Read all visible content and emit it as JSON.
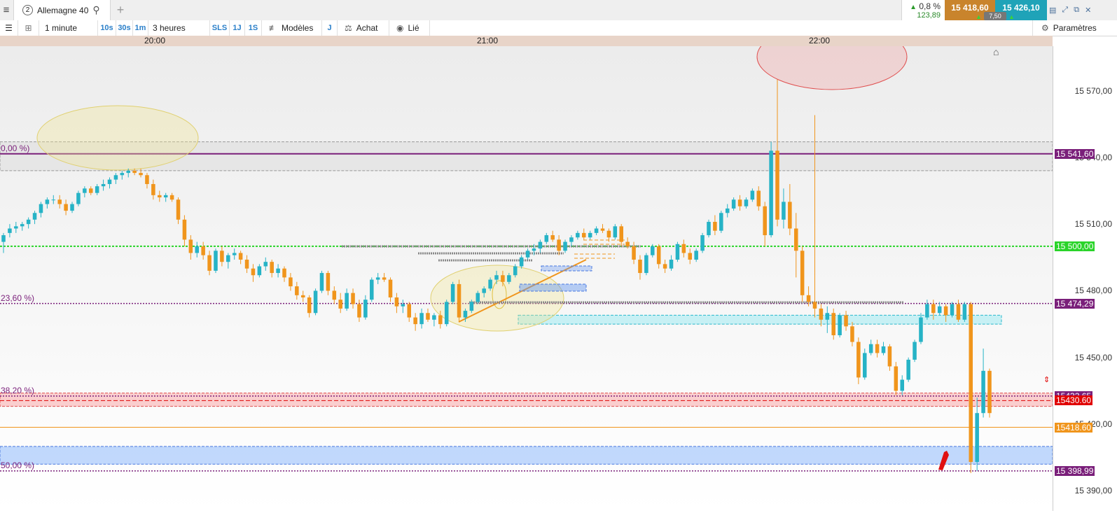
{
  "topbar": {
    "tab_number": "2",
    "instrument": "Allemagne 40",
    "change_pct": "0,8 %",
    "change_pts": "123,89",
    "sell_price": "15 418,60",
    "buy_price": "15 426,10",
    "spread": "7,50"
  },
  "toolbar": {
    "timeframe": "1 minute",
    "tf_10s": "10s",
    "tf_30s": "30s",
    "tf_1m": "1m",
    "range": "3 heures",
    "sls": "SLS",
    "one_j": "1J",
    "one_s": "1S",
    "models": "Modèles",
    "j": "J",
    "buy": "Achat",
    "linked": "Lié",
    "settings": "Paramètres"
  },
  "colors": {
    "bull": "#26b3c6",
    "bear": "#f0951c",
    "fib": "#7a1f7a",
    "green_level": "#2ad42a",
    "order_red": "#e00000",
    "price_orange": "#f0951c"
  },
  "chart_data": {
    "type": "candlestick",
    "instrument": "Allemagne 40",
    "timeframe": "1 minute",
    "x_labels": [
      "20:00",
      "21:00",
      "22:00"
    ],
    "y_ticks": [
      15390,
      15420,
      15450,
      15480,
      15510,
      15540,
      15570
    ],
    "y_tick_labels": [
      "15 390,00",
      "15 420,00",
      "15 450,00",
      "15 480,00",
      "15 510,00",
      "15 540,00",
      "15 570,00"
    ],
    "ylim": [
      15381,
      15590
    ],
    "fib_levels": [
      {
        "label": "0,00 %)",
        "price": 15541.6,
        "tag": "15 541,60"
      },
      {
        "label": "23,60 %)",
        "price": 15474.29,
        "tag": "15 474,29"
      },
      {
        "label": "38,20 %)",
        "price": 15432.65,
        "tag": "15432.65"
      },
      {
        "label": "50,00 %)",
        "price": 15398.99,
        "tag": "15 398,99"
      }
    ],
    "horizontal_levels": [
      {
        "name": "support",
        "price": 15500.0,
        "tag": "15 500,00"
      },
      {
        "name": "order",
        "price": 15430.6,
        "tag": "15430.60"
      },
      {
        "name": "current",
        "price": 15418.6,
        "tag": "15418.60"
      }
    ],
    "zones": [
      {
        "name": "upper-gray",
        "from": 15534,
        "to": 15547
      },
      {
        "name": "red-band",
        "from": 15428,
        "to": 15434
      },
      {
        "name": "blue-zone",
        "from": 15402,
        "to": 15410
      },
      {
        "name": "cyan-zone",
        "from": 15465,
        "to": 15469
      }
    ],
    "candles": [
      {
        "o": 15502,
        "h": 15506,
        "l": 15497,
        "c": 15505
      },
      {
        "o": 15506,
        "h": 15510,
        "l": 15504,
        "c": 15508
      },
      {
        "o": 15508,
        "h": 15511,
        "l": 15506,
        "c": 15509
      },
      {
        "o": 15509,
        "h": 15511,
        "l": 15507,
        "c": 15510
      },
      {
        "o": 15510,
        "h": 15513,
        "l": 15508,
        "c": 15512
      },
      {
        "o": 15512,
        "h": 15516,
        "l": 15510,
        "c": 15515
      },
      {
        "o": 15515,
        "h": 15520,
        "l": 15513,
        "c": 15519
      },
      {
        "o": 15519,
        "h": 15522,
        "l": 15517,
        "c": 15521
      },
      {
        "o": 15521,
        "h": 15523,
        "l": 15519,
        "c": 15521
      },
      {
        "o": 15521,
        "h": 15523,
        "l": 15517,
        "c": 15519
      },
      {
        "o": 15519,
        "h": 15521,
        "l": 15514,
        "c": 15516
      },
      {
        "o": 15516,
        "h": 15520,
        "l": 15515,
        "c": 15519
      },
      {
        "o": 15519,
        "h": 15525,
        "l": 15518,
        "c": 15524
      },
      {
        "o": 15524,
        "h": 15527,
        "l": 15522,
        "c": 15526
      },
      {
        "o": 15526,
        "h": 15527,
        "l": 15523,
        "c": 15524
      },
      {
        "o": 15524,
        "h": 15528,
        "l": 15523,
        "c": 15527
      },
      {
        "o": 15527,
        "h": 15530,
        "l": 15525,
        "c": 15528
      },
      {
        "o": 15528,
        "h": 15531,
        "l": 15526,
        "c": 15530
      },
      {
        "o": 15530,
        "h": 15533,
        "l": 15528,
        "c": 15532
      },
      {
        "o": 15532,
        "h": 15534,
        "l": 15530,
        "c": 15533
      },
      {
        "o": 15533,
        "h": 15535,
        "l": 15531,
        "c": 15534
      },
      {
        "o": 15534,
        "h": 15535,
        "l": 15532,
        "c": 15533
      },
      {
        "o": 15533,
        "h": 15535,
        "l": 15531,
        "c": 15532
      },
      {
        "o": 15532,
        "h": 15533,
        "l": 15526,
        "c": 15528
      },
      {
        "o": 15528,
        "h": 15530,
        "l": 15521,
        "c": 15523
      },
      {
        "o": 15523,
        "h": 15525,
        "l": 15520,
        "c": 15522
      },
      {
        "o": 15522,
        "h": 15524,
        "l": 15520,
        "c": 15523
      },
      {
        "o": 15523,
        "h": 15524,
        "l": 15520,
        "c": 15521
      },
      {
        "o": 15521,
        "h": 15522,
        "l": 15510,
        "c": 15512
      },
      {
        "o": 15512,
        "h": 15514,
        "l": 15500,
        "c": 15503
      },
      {
        "o": 15503,
        "h": 15505,
        "l": 15494,
        "c": 15497
      },
      {
        "o": 15497,
        "h": 15502,
        "l": 15495,
        "c": 15500
      },
      {
        "o": 15500,
        "h": 15502,
        "l": 15494,
        "c": 15496
      },
      {
        "o": 15496,
        "h": 15498,
        "l": 15487,
        "c": 15489
      },
      {
        "o": 15489,
        "h": 15499,
        "l": 15488,
        "c": 15498
      },
      {
        "o": 15498,
        "h": 15500,
        "l": 15491,
        "c": 15493
      },
      {
        "o": 15493,
        "h": 15497,
        "l": 15490,
        "c": 15496
      },
      {
        "o": 15496,
        "h": 15499,
        "l": 15494,
        "c": 15497
      },
      {
        "o": 15497,
        "h": 15498,
        "l": 15492,
        "c": 15494
      },
      {
        "o": 15494,
        "h": 15496,
        "l": 15488,
        "c": 15490
      },
      {
        "o": 15490,
        "h": 15492,
        "l": 15484,
        "c": 15487
      },
      {
        "o": 15487,
        "h": 15492,
        "l": 15486,
        "c": 15491
      },
      {
        "o": 15491,
        "h": 15495,
        "l": 15489,
        "c": 15493
      },
      {
        "o": 15493,
        "h": 15494,
        "l": 15486,
        "c": 15488
      },
      {
        "o": 15488,
        "h": 15492,
        "l": 15486,
        "c": 15490
      },
      {
        "o": 15490,
        "h": 15491,
        "l": 15484,
        "c": 15486
      },
      {
        "o": 15486,
        "h": 15488,
        "l": 15480,
        "c": 15482
      },
      {
        "o": 15482,
        "h": 15484,
        "l": 15476,
        "c": 15478
      },
      {
        "o": 15478,
        "h": 15480,
        "l": 15475,
        "c": 15477
      },
      {
        "o": 15477,
        "h": 15478,
        "l": 15468,
        "c": 15470
      },
      {
        "o": 15470,
        "h": 15481,
        "l": 15469,
        "c": 15480
      },
      {
        "o": 15480,
        "h": 15489,
        "l": 15479,
        "c": 15488
      },
      {
        "o": 15488,
        "h": 15489,
        "l": 15478,
        "c": 15480
      },
      {
        "o": 15480,
        "h": 15482,
        "l": 15474,
        "c": 15476
      },
      {
        "o": 15476,
        "h": 15479,
        "l": 15470,
        "c": 15472
      },
      {
        "o": 15472,
        "h": 15481,
        "l": 15471,
        "c": 15479
      },
      {
        "o": 15479,
        "h": 15481,
        "l": 15472,
        "c": 15474
      },
      {
        "o": 15474,
        "h": 15476,
        "l": 15466,
        "c": 15468
      },
      {
        "o": 15468,
        "h": 15478,
        "l": 15467,
        "c": 15476
      },
      {
        "o": 15476,
        "h": 15486,
        "l": 15475,
        "c": 15485
      },
      {
        "o": 15485,
        "h": 15488,
        "l": 15483,
        "c": 15486
      },
      {
        "o": 15486,
        "h": 15488,
        "l": 15484,
        "c": 15485
      },
      {
        "o": 15485,
        "h": 15486,
        "l": 15475,
        "c": 15477
      },
      {
        "o": 15477,
        "h": 15479,
        "l": 15470,
        "c": 15473
      },
      {
        "o": 15473,
        "h": 15476,
        "l": 15470,
        "c": 15474
      },
      {
        "o": 15474,
        "h": 15475,
        "l": 15466,
        "c": 15468
      },
      {
        "o": 15468,
        "h": 15470,
        "l": 15462,
        "c": 15465
      },
      {
        "o": 15465,
        "h": 15472,
        "l": 15463,
        "c": 15470
      },
      {
        "o": 15470,
        "h": 15472,
        "l": 15466,
        "c": 15467
      },
      {
        "o": 15467,
        "h": 15470,
        "l": 15464,
        "c": 15469
      },
      {
        "o": 15469,
        "h": 15471,
        "l": 15463,
        "c": 15465
      },
      {
        "o": 15465,
        "h": 15476,
        "l": 15464,
        "c": 15475
      },
      {
        "o": 15475,
        "h": 15484,
        "l": 15474,
        "c": 15483
      },
      {
        "o": 15483,
        "h": 15485,
        "l": 15466,
        "c": 15468
      },
      {
        "o": 15468,
        "h": 15472,
        "l": 15466,
        "c": 15471
      },
      {
        "o": 15471,
        "h": 15476,
        "l": 15470,
        "c": 15475
      },
      {
        "o": 15475,
        "h": 15480,
        "l": 15474,
        "c": 15479
      },
      {
        "o": 15479,
        "h": 15482,
        "l": 15477,
        "c": 15481
      },
      {
        "o": 15481,
        "h": 15486,
        "l": 15480,
        "c": 15485
      },
      {
        "o": 15485,
        "h": 15489,
        "l": 15483,
        "c": 15487
      },
      {
        "o": 15487,
        "h": 15489,
        "l": 15482,
        "c": 15484
      },
      {
        "o": 15484,
        "h": 15488,
        "l": 15483,
        "c": 15487
      },
      {
        "o": 15487,
        "h": 15492,
        "l": 15486,
        "c": 15491
      },
      {
        "o": 15491,
        "h": 15496,
        "l": 15490,
        "c": 15495
      },
      {
        "o": 15495,
        "h": 15499,
        "l": 15494,
        "c": 15498
      },
      {
        "o": 15498,
        "h": 15501,
        "l": 15496,
        "c": 15499
      },
      {
        "o": 15499,
        "h": 15503,
        "l": 15497,
        "c": 15502
      },
      {
        "o": 15502,
        "h": 15506,
        "l": 15501,
        "c": 15505
      },
      {
        "o": 15505,
        "h": 15507,
        "l": 15502,
        "c": 15503
      },
      {
        "o": 15503,
        "h": 15505,
        "l": 15496,
        "c": 15498
      },
      {
        "o": 15498,
        "h": 15503,
        "l": 15497,
        "c": 15502
      },
      {
        "o": 15502,
        "h": 15505,
        "l": 15500,
        "c": 15504
      },
      {
        "o": 15504,
        "h": 15507,
        "l": 15503,
        "c": 15506
      },
      {
        "o": 15506,
        "h": 15508,
        "l": 15503,
        "c": 15504
      },
      {
        "o": 15504,
        "h": 15507,
        "l": 15503,
        "c": 15506
      },
      {
        "o": 15506,
        "h": 15509,
        "l": 15505,
        "c": 15508
      },
      {
        "o": 15508,
        "h": 15510,
        "l": 15506,
        "c": 15507
      },
      {
        "o": 15507,
        "h": 15508,
        "l": 15502,
        "c": 15504
      },
      {
        "o": 15504,
        "h": 15510,
        "l": 15503,
        "c": 15509
      },
      {
        "o": 15509,
        "h": 15510,
        "l": 15500,
        "c": 15502
      },
      {
        "o": 15502,
        "h": 15504,
        "l": 15499,
        "c": 15500
      },
      {
        "o": 15500,
        "h": 15502,
        "l": 15492,
        "c": 15494
      },
      {
        "o": 15494,
        "h": 15496,
        "l": 15485,
        "c": 15488
      },
      {
        "o": 15488,
        "h": 15497,
        "l": 15487,
        "c": 15496
      },
      {
        "o": 15496,
        "h": 15501,
        "l": 15495,
        "c": 15500
      },
      {
        "o": 15500,
        "h": 15501,
        "l": 15490,
        "c": 15492
      },
      {
        "o": 15492,
        "h": 15494,
        "l": 15488,
        "c": 15490
      },
      {
        "o": 15490,
        "h": 15496,
        "l": 15489,
        "c": 15494
      },
      {
        "o": 15494,
        "h": 15502,
        "l": 15493,
        "c": 15501
      },
      {
        "o": 15501,
        "h": 15503,
        "l": 15495,
        "c": 15497
      },
      {
        "o": 15497,
        "h": 15499,
        "l": 15492,
        "c": 15494
      },
      {
        "o": 15494,
        "h": 15499,
        "l": 15493,
        "c": 15498
      },
      {
        "o": 15498,
        "h": 15506,
        "l": 15497,
        "c": 15505
      },
      {
        "o": 15505,
        "h": 15512,
        "l": 15504,
        "c": 15511
      },
      {
        "o": 15511,
        "h": 15514,
        "l": 15505,
        "c": 15507
      },
      {
        "o": 15507,
        "h": 15516,
        "l": 15506,
        "c": 15515
      },
      {
        "o": 15515,
        "h": 15519,
        "l": 15513,
        "c": 15517
      },
      {
        "o": 15517,
        "h": 15522,
        "l": 15516,
        "c": 15521
      },
      {
        "o": 15521,
        "h": 15523,
        "l": 15516,
        "c": 15518
      },
      {
        "o": 15518,
        "h": 15522,
        "l": 15517,
        "c": 15521
      },
      {
        "o": 15521,
        "h": 15526,
        "l": 15520,
        "c": 15525
      },
      {
        "o": 15525,
        "h": 15527,
        "l": 15516,
        "c": 15518
      },
      {
        "o": 15518,
        "h": 15520,
        "l": 15500,
        "c": 15505
      },
      {
        "o": 15505,
        "h": 15547,
        "l": 15504,
        "c": 15543
      },
      {
        "o": 15543,
        "h": 15575,
        "l": 15509,
        "c": 15512
      },
      {
        "o": 15512,
        "h": 15526,
        "l": 15508,
        "c": 15520
      },
      {
        "o": 15520,
        "h": 15528,
        "l": 15505,
        "c": 15508
      },
      {
        "o": 15508,
        "h": 15515,
        "l": 15486,
        "c": 15498
      },
      {
        "o": 15498,
        "h": 15500,
        "l": 15475,
        "c": 15478
      },
      {
        "o": 15478,
        "h": 15482,
        "l": 15473,
        "c": 15475
      },
      {
        "o": 15475,
        "h": 15559,
        "l": 15468,
        "c": 15472
      },
      {
        "o": 15472,
        "h": 15474,
        "l": 15464,
        "c": 15467
      },
      {
        "o": 15467,
        "h": 15473,
        "l": 15461,
        "c": 15470
      },
      {
        "o": 15470,
        "h": 15472,
        "l": 15458,
        "c": 15460
      },
      {
        "o": 15460,
        "h": 15470,
        "l": 15459,
        "c": 15469
      },
      {
        "o": 15469,
        "h": 15471,
        "l": 15462,
        "c": 15464
      },
      {
        "o": 15464,
        "h": 15466,
        "l": 15455,
        "c": 15457
      },
      {
        "o": 15457,
        "h": 15459,
        "l": 15438,
        "c": 15441
      },
      {
        "o": 15441,
        "h": 15454,
        "l": 15440,
        "c": 15452
      },
      {
        "o": 15452,
        "h": 15458,
        "l": 15451,
        "c": 15456
      },
      {
        "o": 15456,
        "h": 15458,
        "l": 15450,
        "c": 15452
      },
      {
        "o": 15452,
        "h": 15457,
        "l": 15451,
        "c": 15455
      },
      {
        "o": 15455,
        "h": 15456,
        "l": 15444,
        "c": 15446
      },
      {
        "o": 15446,
        "h": 15448,
        "l": 15433,
        "c": 15435
      },
      {
        "o": 15435,
        "h": 15442,
        "l": 15433,
        "c": 15440
      },
      {
        "o": 15440,
        "h": 15450,
        "l": 15439,
        "c": 15449
      },
      {
        "o": 15449,
        "h": 15458,
        "l": 15448,
        "c": 15457
      },
      {
        "o": 15457,
        "h": 15470,
        "l": 15456,
        "c": 15468
      },
      {
        "o": 15468,
        "h": 15476,
        "l": 15467,
        "c": 15474
      },
      {
        "o": 15474,
        "h": 15476,
        "l": 15467,
        "c": 15470
      },
      {
        "o": 15470,
        "h": 15475,
        "l": 15469,
        "c": 15473
      },
      {
        "o": 15473,
        "h": 15474,
        "l": 15466,
        "c": 15469
      },
      {
        "o": 15469,
        "h": 15475,
        "l": 15468,
        "c": 15474
      },
      {
        "o": 15474,
        "h": 15476,
        "l": 15466,
        "c": 15467
      },
      {
        "o": 15467,
        "h": 15475,
        "l": 15466,
        "c": 15474
      },
      {
        "o": 15474,
        "h": 15475,
        "l": 15398,
        "c": 15403
      },
      {
        "o": 15403,
        "h": 15432,
        "l": 15399,
        "c": 15425
      },
      {
        "o": 15425,
        "h": 15454,
        "l": 15423,
        "c": 15444
      },
      {
        "o": 15444,
        "h": 15445,
        "l": 15423,
        "c": 15425
      }
    ]
  }
}
